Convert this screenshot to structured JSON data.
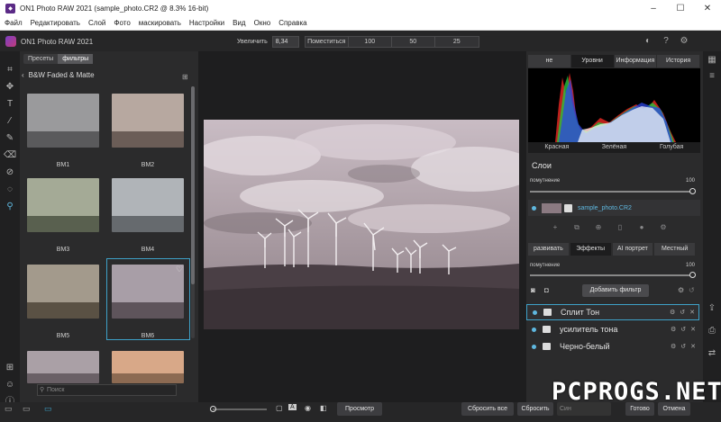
{
  "window": {
    "title": "ON1 Photo RAW 2021 (sample_photo.CR2 @ 8.3% 16-bit)",
    "minimize_icon": "minimize-icon",
    "maximize_icon": "maximize-icon",
    "close_icon": "close-icon"
  },
  "menu": [
    "Файл",
    "Редактировать",
    "Слой",
    "Фото",
    "маскировать",
    "Настройки",
    "Вид",
    "Окно",
    "Справка"
  ],
  "header": {
    "brand": "ON1 Photo RAW 2021",
    "zoom_label": "Увеличить",
    "zoom_value": "8,34",
    "zoom_options": [
      "Поместиться",
      "100",
      "50",
      "25"
    ]
  },
  "browser": {
    "tabs": [
      "Пресеты",
      "фильтры"
    ],
    "active_tab": "фильтры",
    "breadcrumb": "B&W Faded & Matte",
    "presets": [
      {
        "label": "BM1",
        "sky": "#9a9a9c",
        "land": "#5a5a5c"
      },
      {
        "label": "BM2",
        "sky": "#b7a8a0",
        "land": "#6b5d57"
      },
      {
        "label": "BM3",
        "sky": "#a4aa96",
        "land": "#59604f"
      },
      {
        "label": "BM4",
        "sky": "#b0b4b8",
        "land": "#666a6e"
      },
      {
        "label": "BM5",
        "sky": "#a39a8c",
        "land": "#5a5144"
      },
      {
        "label": "BM6",
        "sky": "#a89ea7",
        "land": "#5e545b"
      },
      {
        "label": "",
        "sky": "#aaa0a6",
        "land": "#6a6066"
      },
      {
        "label": "",
        "sky": "#d8a888",
        "land": "#8c6a52"
      }
    ],
    "selected": "BM6",
    "search_placeholder": "Поиск"
  },
  "right_panel": {
    "top_tabs": [
      "не",
      "Уровни",
      "Информация",
      "История"
    ],
    "active_top_tab": "Уровни",
    "histogram_channels": [
      "Красная",
      "Зелёная",
      "Голубая"
    ],
    "layers_title": "Слои",
    "opacity_label": "помутнение",
    "opacity_value": "100",
    "layer_name": "sample_photo.CR2",
    "module_tabs": [
      "развивать",
      "Эффекты",
      "AI портрет",
      "Местный"
    ],
    "active_module_tab": "Эффекты",
    "effects_opacity_label": "помутнение",
    "effects_opacity_value": "100",
    "add_filter": "Добавить фильтр",
    "filters": [
      "Сплит Тон",
      "усилитель тона",
      "Черно-белый"
    ]
  },
  "bottom": {
    "preview": "Просмотр",
    "reset_all": "Сбросить все",
    "reset": "Сбросить",
    "sync_partial": "Син",
    "done": "Готово",
    "cancel": "Отмена"
  },
  "watermark": "PCPROGS.NET"
}
